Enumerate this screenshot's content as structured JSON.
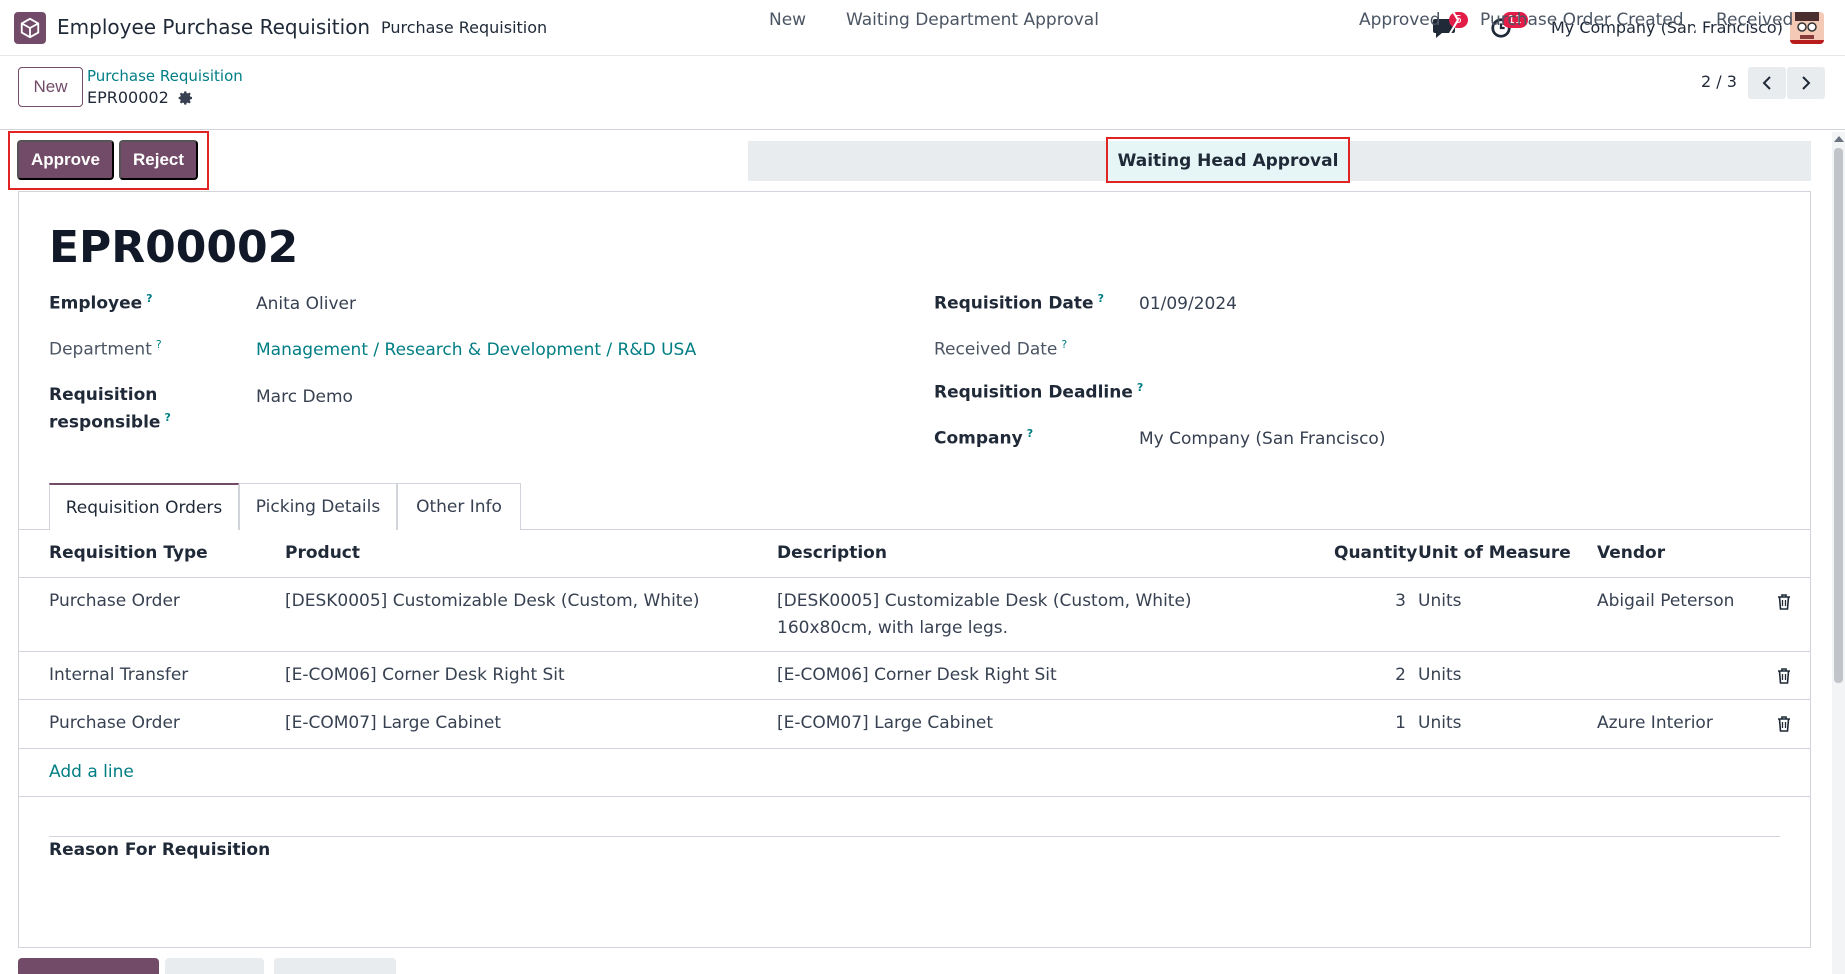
{
  "navbar": {
    "app_title": "Employee Purchase Requisition",
    "menu_item": "Purchase Requisition",
    "chat_badge": "5",
    "activity_badge": "11",
    "company": "My Company (San Francisco)"
  },
  "control": {
    "new_label": "New",
    "breadcrumb_parent": "Purchase Requisition",
    "breadcrumb_current": "EPR00002",
    "pager": "2 / 3"
  },
  "actions": {
    "approve": "Approve",
    "reject": "Reject"
  },
  "statusbar": {
    "stages": [
      "New",
      "Waiting Department Approval",
      "Waiting Head Approval",
      "Approved",
      "Purchase Order Created",
      "Received"
    ],
    "active": "Waiting Head Approval"
  },
  "form": {
    "title": "EPR00002",
    "employee_label": "Employee",
    "employee_value": "Anita Oliver",
    "department_label": "Department",
    "department_value": "Management / Research & Development / R&D USA",
    "responsible_label_1": "Requisition",
    "responsible_label_2": "responsible",
    "responsible_value": "Marc Demo",
    "req_date_label": "Requisition Date",
    "req_date_value": "01/09/2024",
    "received_date_label": "Received Date",
    "deadline_label": "Requisition Deadline",
    "company_label": "Company",
    "company_value": "My Company (San Francisco)",
    "help_mark": "?"
  },
  "tabs": [
    "Requisition Orders",
    "Picking Details",
    "Other Info"
  ],
  "table": {
    "headers": [
      "Requisition Type",
      "Product",
      "Description",
      "Quantity",
      "Unit of Measure",
      "Vendor"
    ],
    "rows": [
      {
        "type": "Purchase Order",
        "product": "[DESK0005] Customizable Desk (Custom, White)",
        "desc1": "[DESK0005] Customizable Desk (Custom, White)",
        "desc2": "160x80cm, with large legs.",
        "qty": "3",
        "uom": "Units",
        "vendor": "Abigail Peterson"
      },
      {
        "type": "Internal Transfer",
        "product": "[E-COM06] Corner Desk Right Sit",
        "desc1": "[E-COM06] Corner Desk Right Sit",
        "desc2": "",
        "qty": "2",
        "uom": "Units",
        "vendor": ""
      },
      {
        "type": "Purchase Order",
        "product": "[E-COM07] Large Cabinet",
        "desc1": "[E-COM07] Large Cabinet",
        "desc2": "",
        "qty": "1",
        "uom": "Units",
        "vendor": "Azure Interior"
      }
    ],
    "add_line": "Add a line"
  },
  "reason": {
    "label": "Reason For Requisition"
  },
  "colors": {
    "brand": "#714B67",
    "link": "#017e84",
    "highlight": "#e02424"
  }
}
